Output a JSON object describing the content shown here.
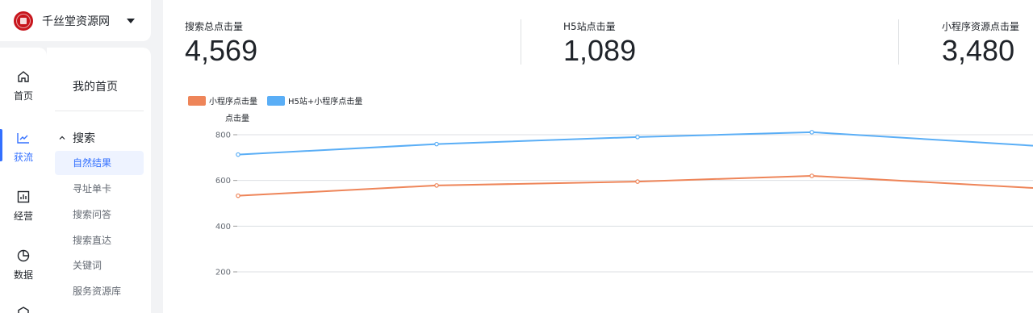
{
  "brand": {
    "name": "千丝堂资源网"
  },
  "rail": [
    {
      "label": "首页",
      "icon": "home-icon"
    },
    {
      "label": "获流",
      "icon": "trend-icon"
    },
    {
      "label": "经营",
      "icon": "bar-chart-icon"
    },
    {
      "label": "数据",
      "icon": "pie-chart-icon"
    }
  ],
  "menu": {
    "home": "我的首页",
    "group": "搜索",
    "items": [
      {
        "label": "自然结果"
      },
      {
        "label": "寻址单卡"
      },
      {
        "label": "搜索问答"
      },
      {
        "label": "搜索直达"
      },
      {
        "label": "关键词"
      },
      {
        "label": "服务资源库"
      }
    ]
  },
  "stats": [
    {
      "label": "搜索总点击量",
      "value": "4,569"
    },
    {
      "label": "H5站点击量",
      "value": "1,089"
    },
    {
      "label": "小程序资源点击量",
      "value": "3,480"
    }
  ],
  "colors": {
    "accent": "#3370ff",
    "series_orange": "#ee8559",
    "series_blue": "#5aaef6"
  },
  "chart_data": {
    "type": "line",
    "ylabel": "点击量",
    "yticks": [
      200,
      400,
      600,
      800
    ],
    "ylim": [
      150,
      830
    ],
    "legend_position": "top-left",
    "grid": true,
    "series": [
      {
        "name": "小程序点击量",
        "color": "#ee8559",
        "values": [
          533,
          578,
          595,
          620,
          567
        ]
      },
      {
        "name": "H5站+小程序点击量",
        "color": "#5aaef6",
        "values": [
          713,
          759,
          790,
          811,
          752
        ]
      }
    ]
  }
}
